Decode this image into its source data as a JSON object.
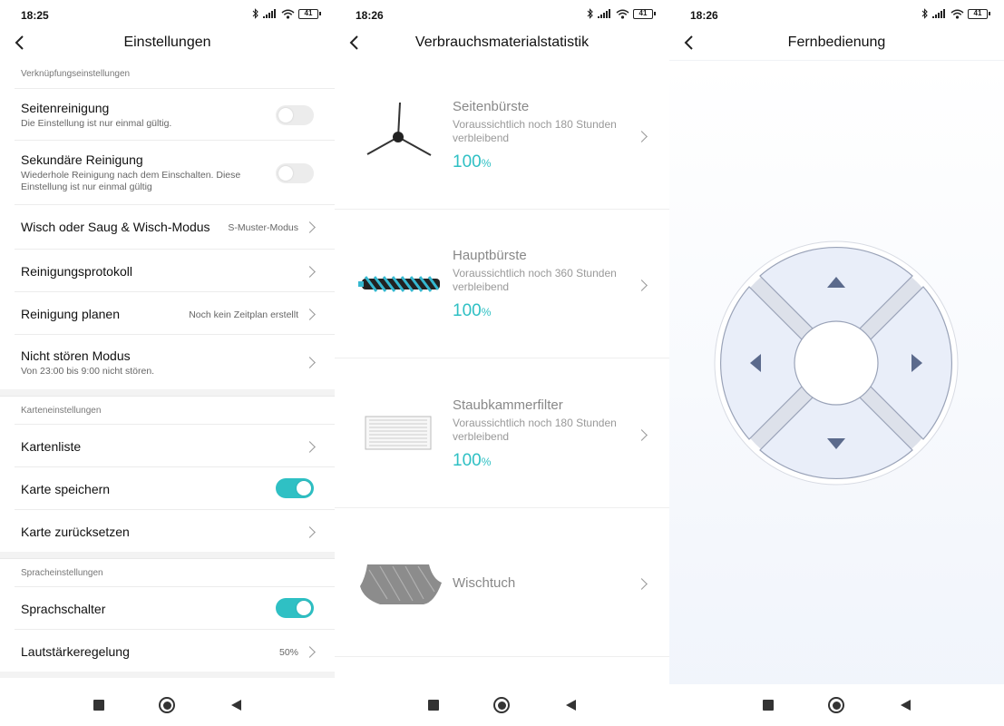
{
  "screens": [
    {
      "time": "18:25",
      "battery": "41",
      "title": "Einstellungen",
      "sections": [
        {
          "header": "Verknüpfungseinstellungen",
          "rows": [
            {
              "label": "Seitenreinigung",
              "sub": "Die Einstellung ist nur einmal gültig.",
              "toggle": false
            },
            {
              "label": "Sekundäre Reinigung",
              "sub": "Wiederhole Reinigung nach dem Einschalten. Diese Einstellung ist nur einmal gültig",
              "toggle": false
            },
            {
              "label": "Wisch oder Saug & Wisch-Modus",
              "value": "S-Muster-Modus"
            },
            {
              "label": "Reinigungsprotokoll"
            },
            {
              "label": "Reinigung planen",
              "value": "Noch kein Zeitplan erstellt"
            },
            {
              "label": "Nicht stören Modus",
              "sub": "Von 23:00 bis 9:00 nicht stören."
            }
          ]
        },
        {
          "header": "Karteneinstellungen",
          "rows": [
            {
              "label": "Kartenliste"
            },
            {
              "label": "Karte speichern",
              "toggle": true
            },
            {
              "label": "Karte zurücksetzen"
            }
          ]
        },
        {
          "header": "Spracheinstellungen",
          "rows": [
            {
              "label": "Sprachschalter",
              "toggle": true
            },
            {
              "label": "Lautstärkeregelung",
              "value": "50%"
            }
          ]
        }
      ]
    },
    {
      "time": "18:26",
      "battery": "41",
      "title": "Verbrauchsmaterialstatistik",
      "items": [
        {
          "name": "Seitenbürste",
          "desc": "Voraussichtlich noch 180 Stunden verbleibend",
          "percent": "100",
          "unit": "%",
          "icon": "side-brush-image"
        },
        {
          "name": "Hauptbürste",
          "desc": "Voraussichtlich noch 360 Stunden verbleibend",
          "percent": "100",
          "unit": "%",
          "icon": "main-brush-image"
        },
        {
          "name": "Staubkammerfilter",
          "desc": "Voraussichtlich noch 180 Stunden verbleibend",
          "percent": "100",
          "unit": "%",
          "icon": "filter-image"
        },
        {
          "name": "Wischtuch",
          "icon": "mop-cloth-image"
        }
      ]
    },
    {
      "time": "18:26",
      "battery": "41",
      "title": "Fernbedienung"
    }
  ],
  "colors": {
    "accent": "#2fc0c4",
    "pad": "#e9eef9",
    "arrow": "#5b6a8c"
  }
}
